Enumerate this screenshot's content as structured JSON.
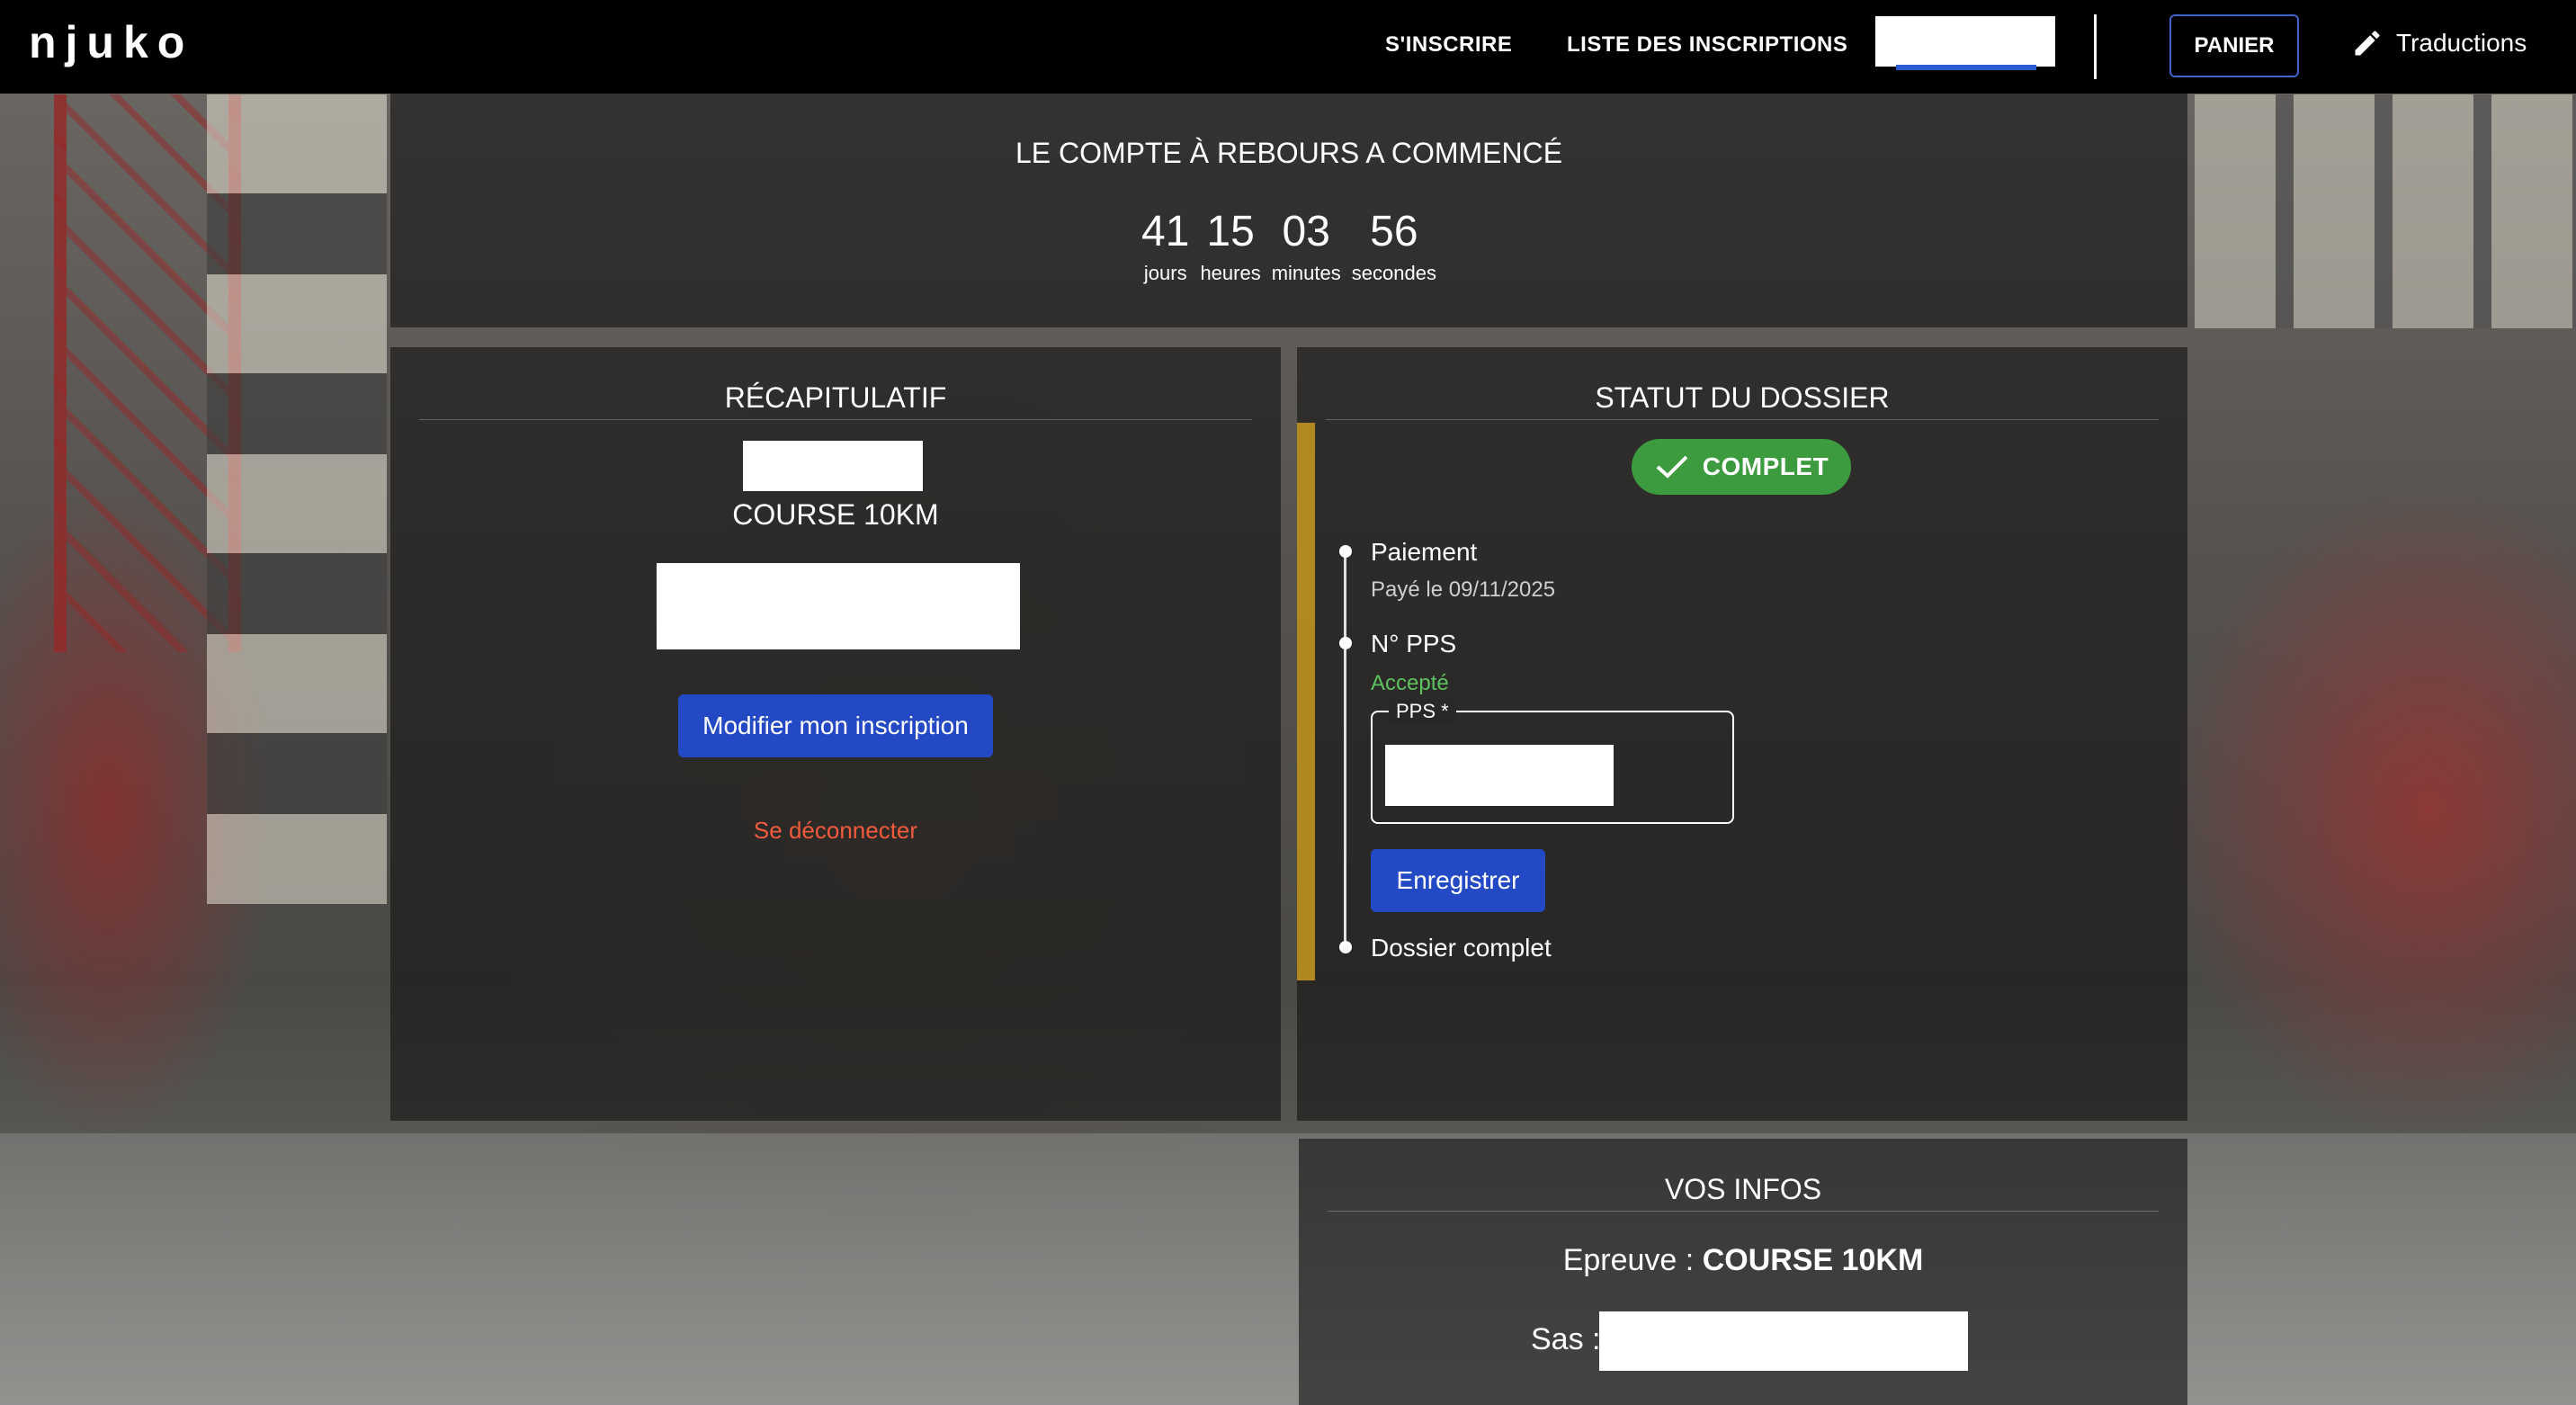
{
  "header": {
    "logo": "njuko",
    "nav": {
      "register": "S'INSCRIRE",
      "registrations_list": "LISTE DES INSCRIPTIONS"
    },
    "cart": "PANIER",
    "translations": "Traductions",
    "icons": {
      "translations": "pencil-icon"
    }
  },
  "countdown": {
    "title": "LE COMPTE À REBOURS A COMMENCÉ",
    "units": [
      {
        "value": "41",
        "label": "jours"
      },
      {
        "value": "15",
        "label": "heures"
      },
      {
        "value": "03",
        "label": "minutes"
      },
      {
        "value": "56",
        "label": "secondes"
      }
    ]
  },
  "recap": {
    "title": "RÉCAPITULATIF",
    "course": "COURSE 10KM",
    "edit_button": "Modifier mon inscription",
    "logout": "Se déconnecter"
  },
  "status": {
    "title": "STATUT DU DOSSIER",
    "badge": "COMPLET",
    "badge_color": "#3c9a3f",
    "steps": [
      {
        "title": "Paiement",
        "sub": "Payé le 09/11/2025"
      },
      {
        "title": "N° PPS",
        "sub": "Accepté"
      },
      {
        "title": "Dossier complet"
      }
    ],
    "pps_label": "PPS *",
    "save_button": "Enregistrer",
    "accepted_color": "#5cc25e"
  },
  "infos": {
    "title": "VOS INFOS",
    "epreuve_label": "Epreuve : ",
    "epreuve_value": "COURSE 10KM",
    "sas_label": "Sas :"
  },
  "colors": {
    "accent": "#2449c4",
    "logout": "#f25a3c"
  }
}
